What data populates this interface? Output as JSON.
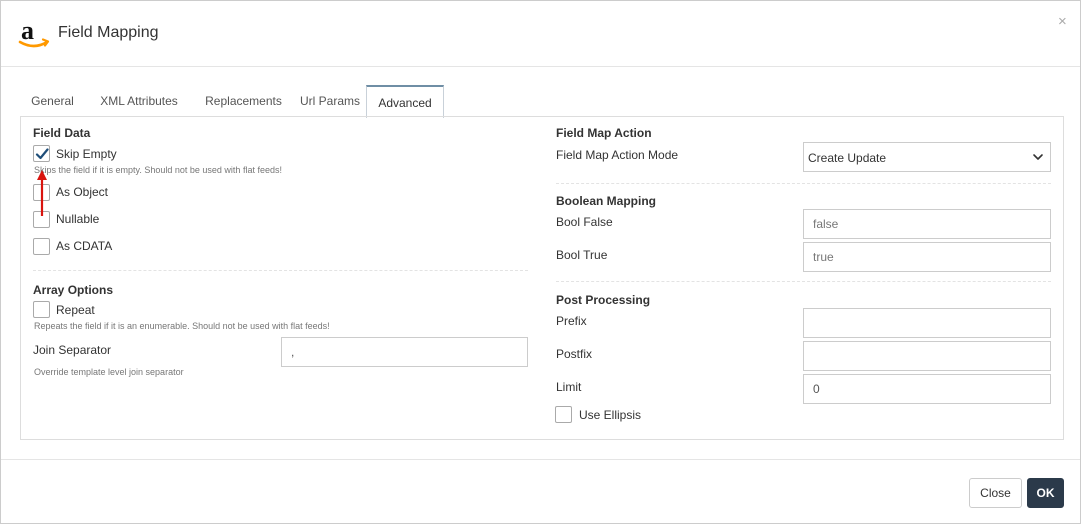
{
  "header": {
    "title": "Field Mapping",
    "logo_icon": "amazon-logo-icon",
    "close_glyph": "×"
  },
  "tabs": [
    {
      "label": "General",
      "active": false
    },
    {
      "label": "XML Attributes",
      "active": false
    },
    {
      "label": "Replacements",
      "active": false
    },
    {
      "label": "Url Params",
      "active": false
    },
    {
      "label": "Advanced",
      "active": true
    }
  ],
  "field_data": {
    "title": "Field Data",
    "skip_empty": {
      "label": "Skip Empty",
      "checked": true,
      "help": "Skips the field if it is empty. Should not be used with flat feeds!"
    },
    "as_object": {
      "label": "As Object",
      "checked": false
    },
    "nullable": {
      "label": "Nullable",
      "checked": false
    },
    "as_cdata": {
      "label": "As CDATA",
      "checked": false
    }
  },
  "array_options": {
    "title": "Array Options",
    "repeat": {
      "label": "Repeat",
      "checked": false,
      "help": "Repeats the field if it is an enumerable. Should not be used with flat feeds!"
    },
    "join_separator": {
      "label": "Join Separator",
      "value": ",",
      "help": "Override template level join separator"
    }
  },
  "field_map_action": {
    "title": "Field Map Action",
    "mode": {
      "label": "Field Map Action Mode",
      "selected": "Create Update"
    }
  },
  "boolean_mapping": {
    "title": "Boolean Mapping",
    "bool_false": {
      "label": "Bool False",
      "placeholder": "false"
    },
    "bool_true": {
      "label": "Bool True",
      "placeholder": "true"
    }
  },
  "post_processing": {
    "title": "Post Processing",
    "prefix": {
      "label": "Prefix",
      "value": ""
    },
    "postfix": {
      "label": "Postfix",
      "value": ""
    },
    "limit": {
      "label": "Limit",
      "value": "0"
    },
    "use_ellipsis": {
      "label": "Use Ellipsis",
      "checked": false
    }
  },
  "footer": {
    "close_label": "Close",
    "ok_label": "OK"
  },
  "colors": {
    "primary_button": "#2b3a4a",
    "active_tab_border": "#6f8ea5",
    "annotation_arrow": "#d9140e",
    "logo_orange": "#f90"
  }
}
